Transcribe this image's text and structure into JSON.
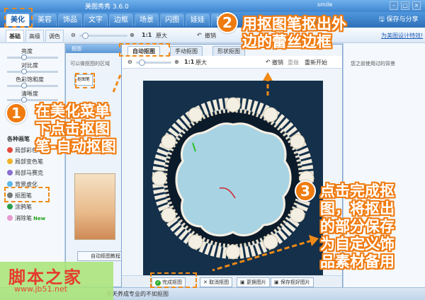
{
  "app": {
    "title": "美图秀秀 3.6.0",
    "user": "smile",
    "save_share": "保存与分享",
    "help_link": "为美图设计特效!",
    "status": "天天养成专业的不如抠图"
  },
  "menu": [
    {
      "label": "美化",
      "active": true
    },
    {
      "label": "美容"
    },
    {
      "label": "饰品"
    },
    {
      "label": "文字"
    },
    {
      "label": "边框"
    },
    {
      "label": "场景"
    },
    {
      "label": "闪图"
    },
    {
      "label": "娃娃"
    },
    {
      "label": "拼图"
    }
  ],
  "toolbar": {
    "tabs": [
      "基础",
      "高级",
      "调色"
    ],
    "ratio": "1:1",
    "original": "原大",
    "undo": "撤销",
    "redo": "重做",
    "reset": "重新开始"
  },
  "left_panel": {
    "sliders": [
      "亮度",
      "对比度",
      "色彩饱和度",
      "清晰度"
    ],
    "brushes_title": "各种画笔",
    "brushes": [
      "局部彩色笔",
      "局部变色笔",
      "局部马赛克",
      "背景虚化",
      "抠图笔",
      "涂鸦笔",
      "消除笔"
    ],
    "new_badge": "New",
    "brush_colors": [
      "#e44b3c",
      "#f0b429",
      "#8a6fd1",
      "#5fb7e8",
      "#777777",
      "#2d9d4a",
      "#e99ad0"
    ]
  },
  "matting_dialog": {
    "title": "抠图",
    "hint": "可以做抠图的区域",
    "cutout_pen": "抠图笔",
    "tutorial_btn": "自动抠图教程"
  },
  "auto_window": {
    "tabs": [
      "自动抠图",
      "手动抠图",
      "形状抠图"
    ],
    "ratio": "1:1",
    "original": "原大",
    "undo": "撤销",
    "redo": "重做",
    "reset": "重新开始",
    "buttons": [
      "完成抠图",
      "取消抠图",
      "更换图片",
      "保存抠好图片"
    ]
  },
  "right_panel": {
    "title": "您之前使用过的背景"
  },
  "annotations": {
    "n1": "1",
    "t1": [
      "在美化菜单",
      "下点击抠图",
      "笔-自动抠图"
    ],
    "n2": "2",
    "t2": [
      "用抠图笔抠出外",
      "边的蕾丝边框"
    ],
    "n3": "3",
    "t3": [
      "点击完成抠",
      "图，将抠出",
      "的部分保存",
      "为自定义饰",
      "品素材备用"
    ]
  },
  "watermark": {
    "cn": "脚本之家",
    "url": "www.jb51.net"
  },
  "colors": {
    "accent": "#f07b10",
    "canvas": "#14304a",
    "frame_inner": "#a8d3e3",
    "brand_blue": "#3f86d0"
  }
}
